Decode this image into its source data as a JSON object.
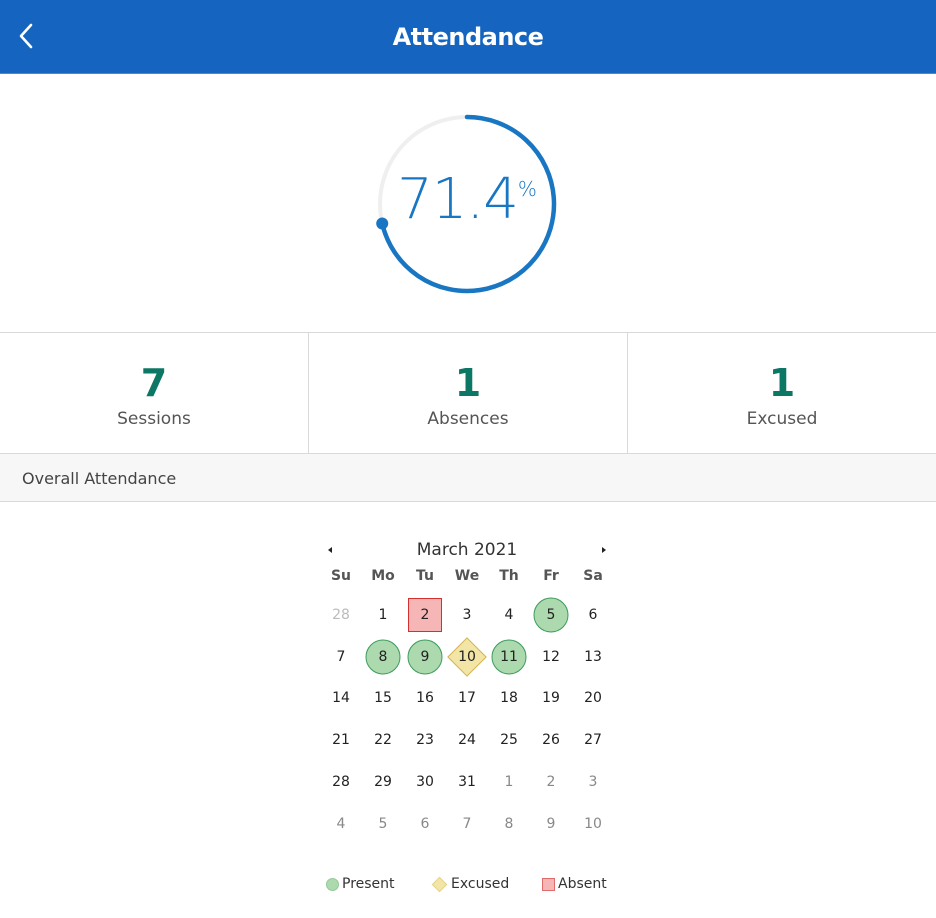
{
  "header": {
    "title": "Attendance",
    "back_icon": "chevron-left-icon"
  },
  "gauge": {
    "value": "71.4",
    "unit": "%",
    "fraction": 0.714,
    "color": "#1976c2",
    "track_color": "#efefef"
  },
  "stats": [
    {
      "value": "7",
      "label": "Sessions"
    },
    {
      "value": "1",
      "label": "Absences"
    },
    {
      "value": "1",
      "label": "Excused"
    }
  ],
  "section": {
    "title": "Overall Attendance"
  },
  "calendar": {
    "title": "March 2021",
    "prev_icon": "caret-left-icon",
    "next_icon": "caret-right-icon",
    "weekdays": [
      "Su",
      "Mo",
      "Tu",
      "We",
      "Th",
      "Fr",
      "Sa"
    ],
    "days": [
      {
        "n": "28",
        "cls": "other faint"
      },
      {
        "n": "1"
      },
      {
        "n": "2",
        "status": "absent"
      },
      {
        "n": "3"
      },
      {
        "n": "4"
      },
      {
        "n": "5",
        "status": "present"
      },
      {
        "n": "6"
      },
      {
        "n": "7"
      },
      {
        "n": "8",
        "status": "present"
      },
      {
        "n": "9",
        "status": "present"
      },
      {
        "n": "10",
        "status": "excused"
      },
      {
        "n": "11",
        "status": "present"
      },
      {
        "n": "12"
      },
      {
        "n": "13"
      },
      {
        "n": "14"
      },
      {
        "n": "15"
      },
      {
        "n": "16"
      },
      {
        "n": "17"
      },
      {
        "n": "18"
      },
      {
        "n": "19"
      },
      {
        "n": "20"
      },
      {
        "n": "21"
      },
      {
        "n": "22"
      },
      {
        "n": "23"
      },
      {
        "n": "24"
      },
      {
        "n": "25"
      },
      {
        "n": "26"
      },
      {
        "n": "27"
      },
      {
        "n": "28"
      },
      {
        "n": "29"
      },
      {
        "n": "30"
      },
      {
        "n": "31"
      },
      {
        "n": "1",
        "cls": "other"
      },
      {
        "n": "2",
        "cls": "other"
      },
      {
        "n": "3",
        "cls": "other"
      },
      {
        "n": "4",
        "cls": "other"
      },
      {
        "n": "5",
        "cls": "other"
      },
      {
        "n": "6",
        "cls": "other"
      },
      {
        "n": "7",
        "cls": "other"
      },
      {
        "n": "8",
        "cls": "other"
      },
      {
        "n": "9",
        "cls": "other"
      },
      {
        "n": "10",
        "cls": "other"
      }
    ]
  },
  "legend": [
    {
      "key": "present",
      "label": "Present",
      "color": "#acd9ad"
    },
    {
      "key": "excused",
      "label": "Excused",
      "color": "#f2e5a6"
    },
    {
      "key": "absent",
      "label": "Absent",
      "color": "#f7b6b6"
    }
  ],
  "colors": {
    "header_bg": "#1565c0",
    "stat_value": "#0d7766"
  }
}
